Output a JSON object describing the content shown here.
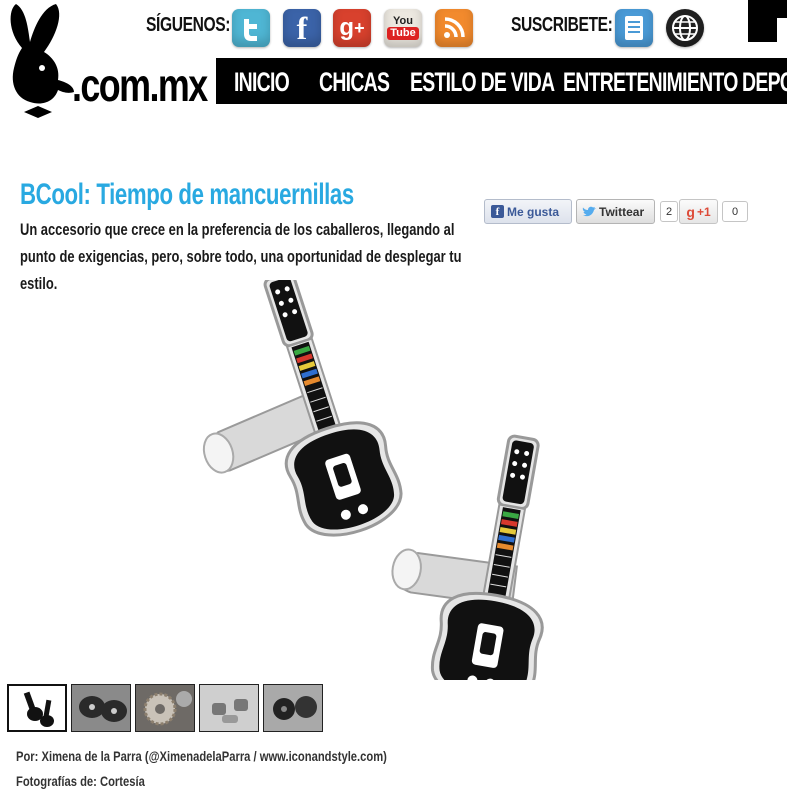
{
  "brand": {
    "logo_text": ".com.mx",
    "logo_icon": "playboy-bunny-icon"
  },
  "social": {
    "follow_label": "SÍGUENOS:",
    "subscribe_label": "SUSCRIBETE:",
    "icons": [
      {
        "name": "twitter-icon",
        "glyph": "t",
        "color": "#4fb6d4"
      },
      {
        "name": "facebook-icon",
        "glyph": "f",
        "color": "#3b63a8"
      },
      {
        "name": "google-plus-icon",
        "glyph": "g+",
        "color": "#d8412d"
      },
      {
        "name": "youtube-icon",
        "glyph": "You Tube",
        "color": "#e8e4dc"
      },
      {
        "name": "rss-icon",
        "glyph": "rss",
        "color": "#f28a2d"
      },
      {
        "name": "document-icon",
        "glyph": "doc",
        "color": "#4a9ad6"
      },
      {
        "name": "globe-icon",
        "glyph": "web",
        "color": "#222222"
      }
    ]
  },
  "nav": {
    "items": [
      "INICIO",
      "CHICAS",
      "ESTILO DE VIDA",
      "ENTRETENIMIENTO",
      "DEPO"
    ]
  },
  "article": {
    "title": "BCool: Tiempo de mancuernillas",
    "subtitle": "Un accesorio que crece en la preferencia de los caballeros, llegando al punto de exigencias, pero, sobre todo, una oportunidad de desplegar tu estilo.",
    "image_alt": "guitar-cufflinks-photo",
    "author_credit": "Por: Ximena de la Parra (@XimenadelaParra / www.iconandstyle.com)",
    "photo_credit": "Fotografías de: Cortesía"
  },
  "share": {
    "like_label": "Me gusta",
    "tweet_label": "Twittear",
    "tweet_count": "2",
    "gplus_label": "+1",
    "gplus_count": "0"
  },
  "colors": {
    "accent": "#29a9e1",
    "nav_bg": "#000000"
  },
  "thumbnails": [
    {
      "name": "thumb-guitar-cufflinks",
      "active": true
    },
    {
      "name": "thumb-dark-cufflinks",
      "active": false
    },
    {
      "name": "thumb-gear-cufflinks",
      "active": false
    },
    {
      "name": "thumb-silver-cufflinks",
      "active": false
    },
    {
      "name": "thumb-black-cufflinks",
      "active": false
    }
  ]
}
